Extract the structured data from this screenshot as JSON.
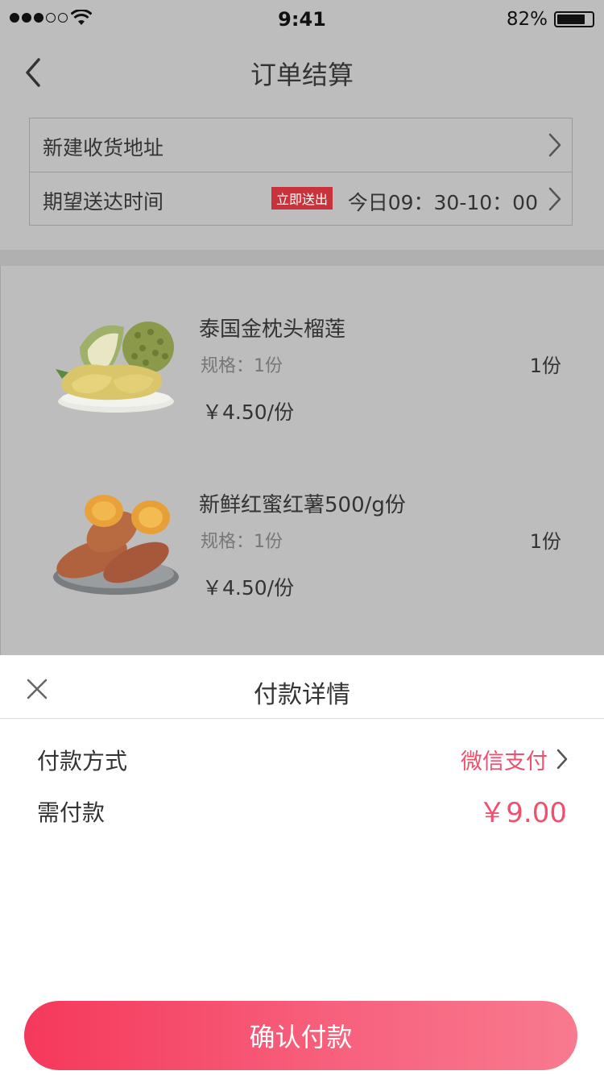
{
  "status_bar": {
    "time": "9:41",
    "battery_percent": "82%",
    "battery_level": 0.82,
    "signal_bars": 3,
    "signal_total": 5,
    "wifi_icon": "wifi-icon"
  },
  "nav": {
    "back_icon": "chevron-left-icon",
    "title": "订单结算"
  },
  "address": {
    "new_address_label": "新建收货地址",
    "delivery_time_label": "期望送达时间",
    "instant_badge": "立即送出",
    "delivery_time_value": "今日09：30-10：00"
  },
  "products": [
    {
      "name": "泰国金枕头榴莲",
      "spec": "规格：1份",
      "quantity": "1份",
      "price": "￥4.50/份",
      "image": "durian-image"
    },
    {
      "name": "新鲜红蜜红薯500/g份",
      "spec": "规格：1份",
      "quantity": "1份",
      "price": "￥4.50/份",
      "image": "sweet-potato-image"
    }
  ],
  "payment": {
    "title": "付款详情",
    "method_label": "付款方式",
    "method_value": "微信支付",
    "amount_label": "需付款",
    "amount_value": "￥9.00",
    "confirm_label": "确认付款"
  },
  "colors": {
    "accent": "#f0506e",
    "badge": "#c8323a",
    "overlay": "#bdbdbd"
  }
}
